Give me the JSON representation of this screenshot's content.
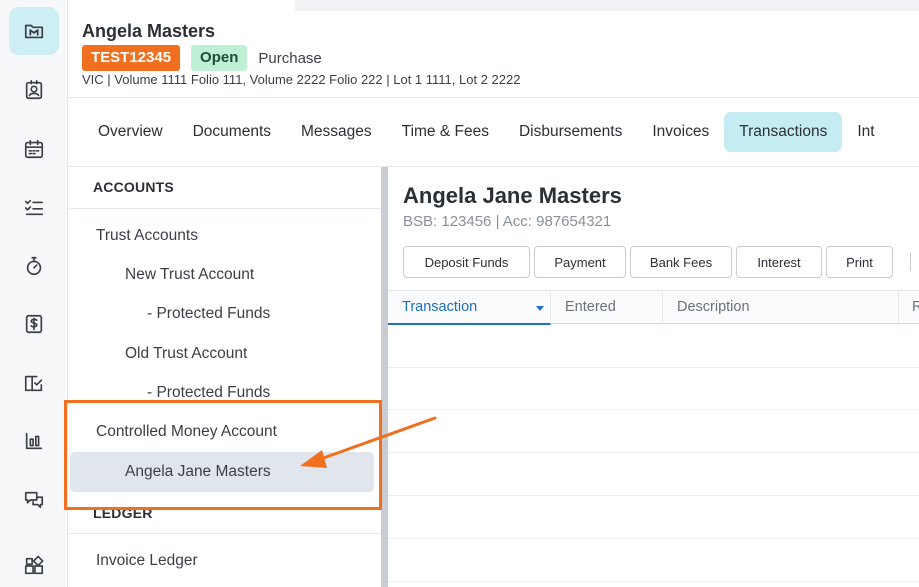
{
  "header": {
    "client_name": "Angela Masters",
    "matter_number": "TEST12345",
    "status": "Open",
    "matter_type": "Purchase",
    "property_line": "VIC | Volume 1111 Folio 111, Volume 2222 Folio 222 | Lot 1 1111, Lot 2 2222"
  },
  "rail": [
    {
      "icon": "matter-logo-icon",
      "active": true
    },
    {
      "icon": "contact-card-icon"
    },
    {
      "icon": "calendar-icon"
    },
    {
      "icon": "checklist-icon"
    },
    {
      "icon": "stopwatch-icon"
    },
    {
      "icon": "dollar-icon"
    },
    {
      "icon": "book-check-icon"
    },
    {
      "icon": "bar-chart-icon"
    },
    {
      "icon": "chat-bubbles-icon"
    },
    {
      "icon": "apps-grid-icon"
    }
  ],
  "tabs": [
    {
      "label": "Overview"
    },
    {
      "label": "Documents"
    },
    {
      "label": "Messages"
    },
    {
      "label": "Time & Fees"
    },
    {
      "label": "Disbursements"
    },
    {
      "label": "Invoices"
    },
    {
      "label": "Transactions",
      "active": true
    },
    {
      "label": "Int"
    }
  ],
  "accounts": {
    "section_accounts": "ACCOUNTS",
    "trust_accounts": "Trust Accounts",
    "new_trust_account": "New Trust Account",
    "new_protected_funds": "- Protected Funds",
    "old_trust_account": "Old Trust Account",
    "old_protected_funds": "- Protected Funds",
    "controlled_money_account": "Controlled Money Account",
    "selected_account": "Angela Jane Masters",
    "section_ledger": "LEDGER",
    "invoice_ledger": "Invoice Ledger"
  },
  "main": {
    "account_title": "Angela Jane Masters",
    "account_sub": "BSB: 123456 | Acc: 987654321",
    "actions": {
      "deposit_funds": "Deposit Funds",
      "payment": "Payment",
      "bank_fees": "Bank Fees",
      "interest": "Interest",
      "print": "Print"
    },
    "columns": {
      "transaction": "Transaction",
      "entered": "Entered",
      "description": "Description",
      "r": "R"
    }
  },
  "colors": {
    "accent_orange": "#f07020",
    "active_tab_bg": "#c6ecf3",
    "status_green_bg": "#bff0d6",
    "link_blue": "#1f6fc5"
  }
}
